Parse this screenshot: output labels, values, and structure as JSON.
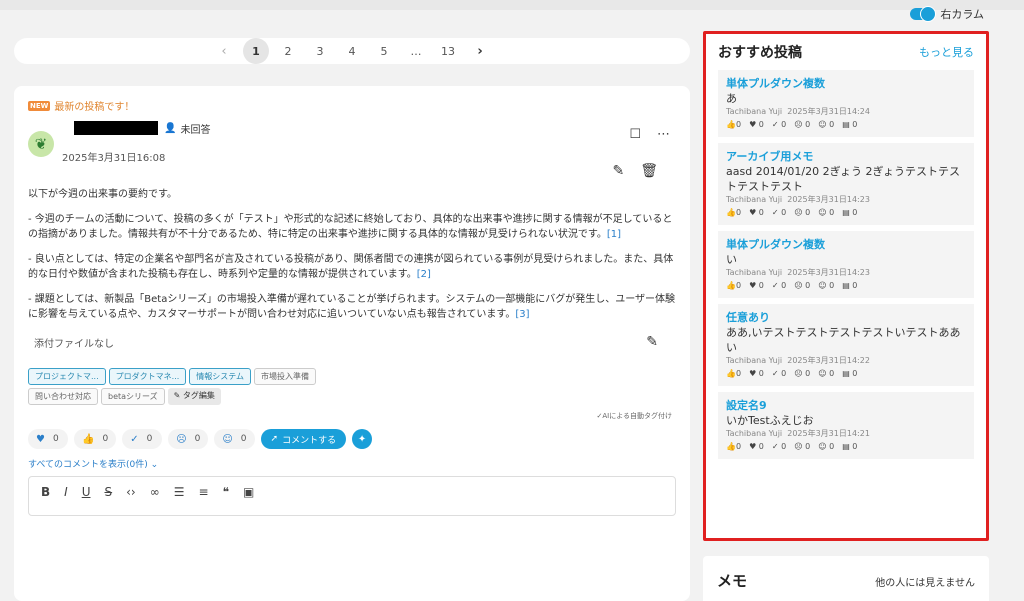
{
  "toggle": {
    "label": "右カラム"
  },
  "pager": {
    "prev": "‹",
    "pages": [
      "1",
      "2",
      "3",
      "4",
      "5",
      "…",
      "13"
    ],
    "next": "›"
  },
  "post": {
    "new_badge": "NEW",
    "new_text": "最新の投稿です！",
    "status": "未回答",
    "date": "2025年3月31日16:08",
    "intro": "以下が今週の出来事の要約です。",
    "p1": "- 今週のチームの活動について、投稿の多くが「テスト」や形式的な記述に終始しており、具体的な出来事や進捗に関する情報が不足しているとの指摘がありました。情報共有が不十分であるため、特に特定の出来事や進捗に関する具体的な情報が見受けられない状況です。",
    "p1_ref": "[1]",
    "p2": "- 良い点としては、特定の企業名や部門名が言及されている投稿があり、関係者間での連携が図られている事例が見受けられました。また、具体的な日付や数値が含まれた投稿も存在し、時系列や定量的な情報が提供されています。",
    "p2_ref": "[2]",
    "p3": "- 課題としては、新製品「Betaシリーズ」の市場投入準備が遅れていることが挙げられます。システムの一部機能にバグが発生し、ユーザー体験に影響を与えている点や、カスタマーサポートが問い合わせ対応に追いついていない点も報告されています。",
    "p3_ref": "[3]",
    "attachment": "添付ファイルなし",
    "tags_blue": [
      "プロジェクトマ...",
      "プロダクトマネ...",
      "情報システム"
    ],
    "tags_gray": [
      "市場投入準備",
      "問い合わせ対応",
      "betaシリーズ"
    ],
    "tag_edit": "タグ編集",
    "ai_note": "✓AIによる自動タグ付け",
    "reactions": [
      "0",
      "0",
      "0",
      "0",
      "0"
    ],
    "comment_button": "コメントする",
    "show_comments": "すべてのコメントを表示(0件)"
  },
  "recommend": {
    "title": "おすすめ投稿",
    "more": "もっと見る",
    "items": [
      {
        "title": "単体プルダウン複数",
        "body": "あ",
        "author": "Tachibana Yuji",
        "date": "2025年3月31日14:24",
        "stats": [
          "0",
          "0",
          "0",
          "0",
          "0",
          "0"
        ]
      },
      {
        "title": "アーカイブ用メモ",
        "body": "aasd 2014/01/20 2ぎょう 2ぎょうテストテストテストテスト",
        "author": "Tachibana Yuji",
        "date": "2025年3月31日14:23",
        "stats": [
          "0",
          "0",
          "0",
          "0",
          "0",
          "0"
        ]
      },
      {
        "title": "単体プルダウン複数",
        "body": "い",
        "author": "Tachibana Yuji",
        "date": "2025年3月31日14:23",
        "stats": [
          "0",
          "0",
          "0",
          "0",
          "0",
          "0"
        ]
      },
      {
        "title": "任意あり",
        "body": "ああ,いテストテストテストテストいテストああ い",
        "author": "Tachibana Yuji",
        "date": "2025年3月31日14:22",
        "stats": [
          "0",
          "0",
          "0",
          "0",
          "0",
          "0"
        ]
      },
      {
        "title": "設定名9",
        "body": "いかTestふえじお",
        "author": "Tachibana Yuji",
        "date": "2025年3月31日14:21",
        "stats": [
          "0",
          "0",
          "0",
          "0",
          "0",
          "0"
        ]
      }
    ]
  },
  "memo": {
    "title": "メモ",
    "note": "他の人には見えません"
  }
}
